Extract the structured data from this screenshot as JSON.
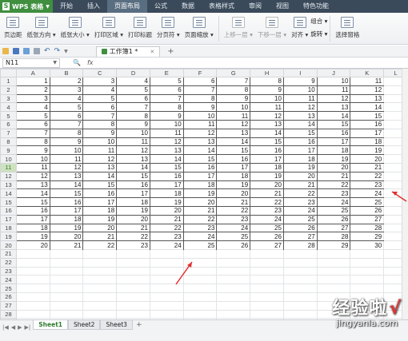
{
  "app": {
    "name": "WPS 表格"
  },
  "menu": {
    "tabs": [
      "开始",
      "插入",
      "页面布局",
      "公式",
      "数据",
      "表格样式",
      "审阅",
      "视图",
      "特色功能"
    ],
    "active_index": 2
  },
  "ribbon": {
    "buttons": [
      {
        "label": "页边距",
        "disabled": false
      },
      {
        "label": "纸张方向 ▾",
        "disabled": false
      },
      {
        "label": "纸张大小 ▾",
        "disabled": false
      },
      {
        "label": "打印区域 ▾",
        "disabled": false
      },
      {
        "label": "打印标题",
        "disabled": false
      },
      {
        "label": "分页符 ▾",
        "disabled": false
      },
      {
        "label": "页面缩放 ▾",
        "disabled": false
      },
      {
        "label": "上移一层 ▾",
        "disabled": true
      },
      {
        "label": "下移一层 ▾",
        "disabled": true
      },
      {
        "label": "对齐 ▾",
        "disabled": false
      }
    ],
    "small": {
      "group": "组合 ▾",
      "rotate": "旋转 ▾"
    },
    "select_pane": "选择窗格"
  },
  "document": {
    "tab_name": "工作簿1 *"
  },
  "formula": {
    "name_box": "N11",
    "fx_label": "fx",
    "value": ""
  },
  "sheet": {
    "columns": [
      "A",
      "B",
      "C",
      "D",
      "E",
      "F",
      "G",
      "H",
      "I",
      "J",
      "K",
      "L"
    ],
    "data_rows": 20,
    "empty_rows": [
      21,
      22,
      23,
      24,
      25,
      26,
      27,
      28,
      29,
      30,
      31,
      32
    ],
    "rows": [
      [
        1,
        2,
        3,
        4,
        5,
        6,
        7,
        8,
        9,
        10,
        11
      ],
      [
        2,
        3,
        4,
        5,
        6,
        7,
        8,
        9,
        10,
        11,
        12
      ],
      [
        3,
        4,
        5,
        6,
        7,
        8,
        9,
        10,
        11,
        12,
        13
      ],
      [
        4,
        5,
        6,
        7,
        8,
        9,
        10,
        11,
        12,
        13,
        14
      ],
      [
        5,
        6,
        7,
        8,
        9,
        10,
        11,
        12,
        13,
        14,
        15
      ],
      [
        6,
        7,
        8,
        9,
        10,
        11,
        12,
        13,
        14,
        15,
        16
      ],
      [
        7,
        8,
        9,
        10,
        11,
        12,
        13,
        14,
        15,
        16,
        17
      ],
      [
        8,
        9,
        10,
        11,
        12,
        13,
        14,
        15,
        16,
        17,
        18
      ],
      [
        9,
        10,
        11,
        12,
        13,
        14,
        15,
        16,
        17,
        18,
        19
      ],
      [
        10,
        11,
        12,
        13,
        14,
        15,
        16,
        17,
        18,
        19,
        20
      ],
      [
        11,
        12,
        13,
        14,
        15,
        16,
        17,
        18,
        19,
        20,
        21
      ],
      [
        12,
        13,
        14,
        15,
        16,
        17,
        18,
        19,
        20,
        21,
        22
      ],
      [
        13,
        14,
        15,
        16,
        17,
        18,
        19,
        20,
        21,
        22,
        23
      ],
      [
        14,
        15,
        16,
        17,
        18,
        19,
        20,
        21,
        22,
        23,
        24
      ],
      [
        15,
        16,
        17,
        18,
        19,
        20,
        21,
        22,
        23,
        24,
        25
      ],
      [
        16,
        17,
        18,
        19,
        20,
        21,
        22,
        23,
        24,
        25,
        26
      ],
      [
        17,
        18,
        19,
        20,
        21,
        22,
        23,
        24,
        25,
        26,
        27
      ],
      [
        18,
        19,
        20,
        21,
        22,
        23,
        24,
        25,
        26,
        27,
        28
      ],
      [
        19,
        20,
        21,
        22,
        23,
        24,
        25,
        26,
        27,
        28,
        29
      ],
      [
        20,
        21,
        22,
        23,
        24,
        25,
        26,
        27,
        28,
        29,
        30
      ]
    ],
    "selected_row": 11,
    "tabs": [
      "Sheet1",
      "Sheet2",
      "Sheet3"
    ],
    "active_tab": 0
  },
  "watermark": {
    "line1": "经验啦",
    "check": "√",
    "line2": "jingyanla.com"
  },
  "colors": {
    "accent": "#3f8f3f",
    "menubar": "#3a4a5a",
    "arrow": "#e03030"
  }
}
